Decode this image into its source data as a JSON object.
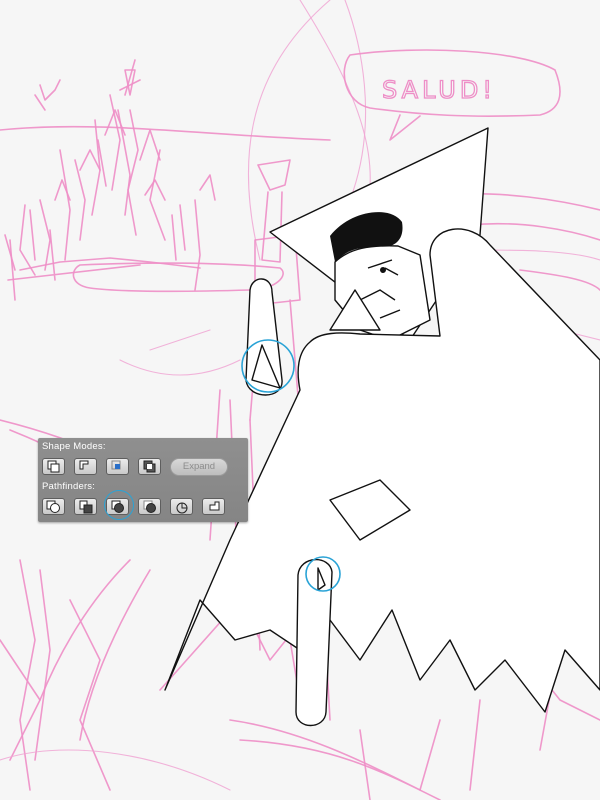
{
  "speech_bubble": {
    "text": "SALUD!"
  },
  "panel": {
    "shape_modes_label": "Shape Modes:",
    "pathfinders_label": "Pathfinders:",
    "expand_label": "Expand",
    "shape_mode_buttons": [
      "unite-icon",
      "minus-front-icon",
      "intersect-icon",
      "exclude-icon"
    ],
    "pathfinder_buttons": [
      "divide-icon",
      "trim-icon",
      "merge-icon",
      "crop-icon",
      "outline-icon",
      "minus-back-icon"
    ],
    "highlighted_button": "merge-icon"
  },
  "colors": {
    "sketch": "#ee8ec7",
    "selection": "#2aa3d6",
    "panel_bg": "#8a8a8a",
    "canvas_bg": "#f6f6f6"
  }
}
